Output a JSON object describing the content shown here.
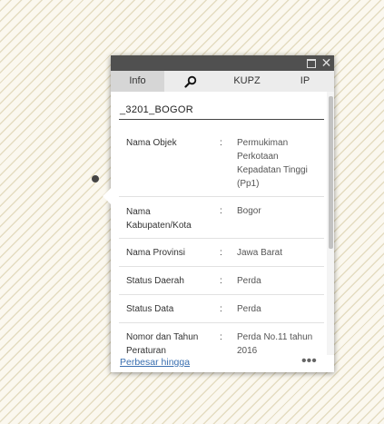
{
  "popup": {
    "tabs": [
      {
        "label": "Info",
        "active": true
      },
      {
        "label": "",
        "icon": "search-icon"
      },
      {
        "label": "KUPZ"
      },
      {
        "label": "IP"
      }
    ],
    "feature_title": "_3201_BOGOR",
    "rows": [
      {
        "label": "Nama Objek",
        "value": "Permukiman Perkotaan Kepadatan Tinggi (Pp1)"
      },
      {
        "label": "Nama Kabupaten/Kota",
        "value": "Bogor"
      },
      {
        "label": "Nama Provinsi",
        "value": "Jawa Barat"
      },
      {
        "label": "Status Daerah",
        "value": "Perda"
      },
      {
        "label": "Status Data",
        "value": "Perda"
      },
      {
        "label": "Nomor dan Tahun Peraturan",
        "value": "Perda No.11 tahun 2016"
      }
    ],
    "colon": ":",
    "footer_link": "Perbesar hingga",
    "more": "•••",
    "close": "✕"
  },
  "colors": {
    "titlebar": "#505050",
    "link": "#3a6fb0",
    "tab_active": "#d6d6d6"
  }
}
